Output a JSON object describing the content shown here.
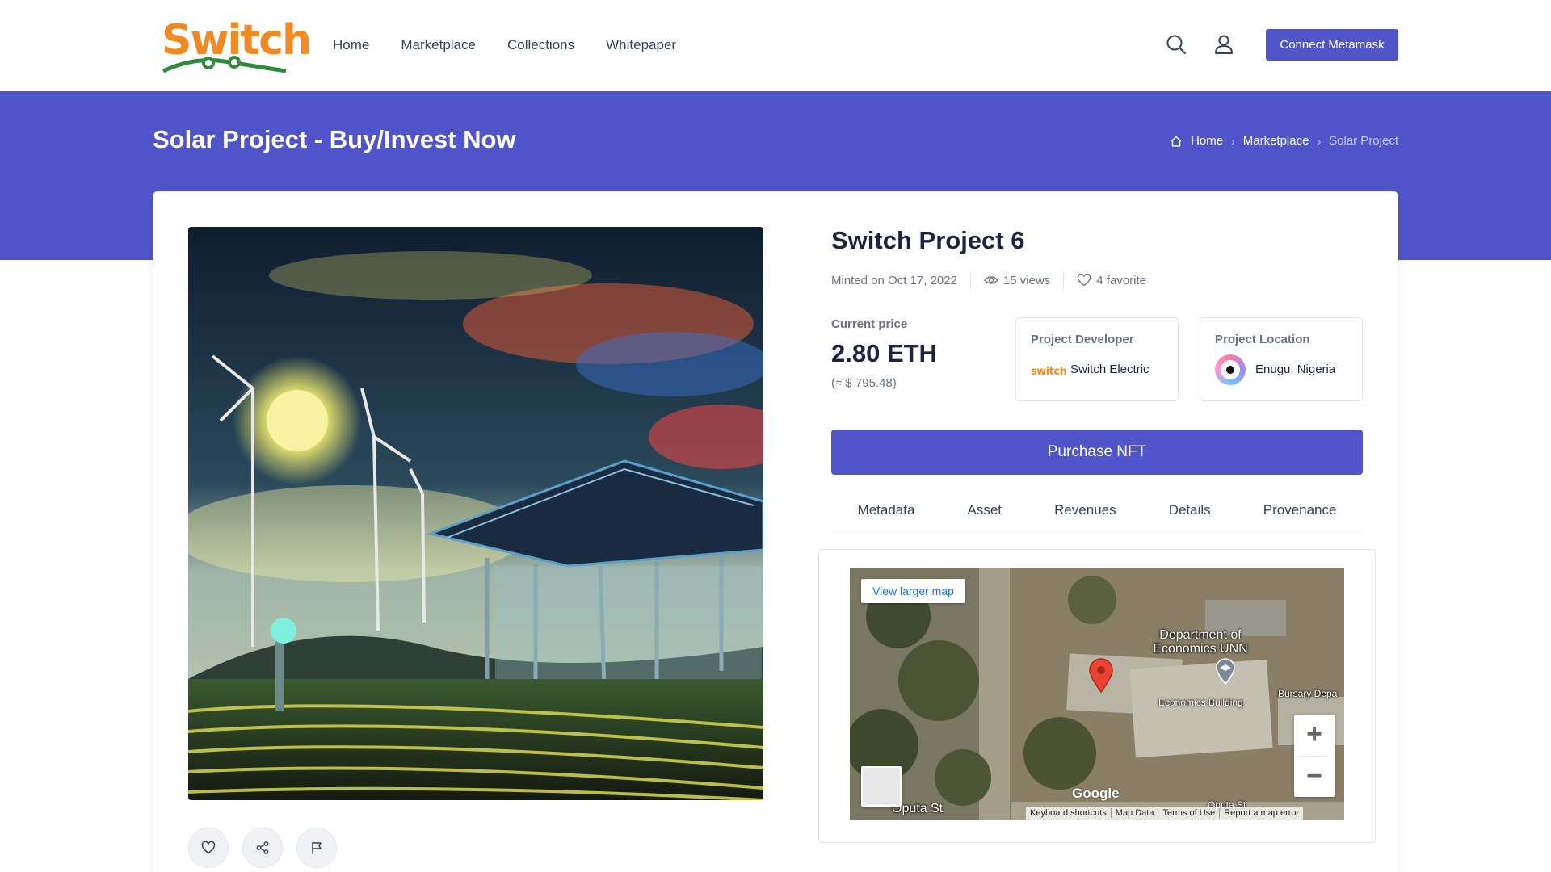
{
  "header": {
    "logo_text": "Switch",
    "nav": [
      "Home",
      "Marketplace",
      "Collections",
      "Whitepaper"
    ],
    "connect_label": "Connect Metamask"
  },
  "banner": {
    "title": "Solar Project - Buy/Invest Now",
    "breadcrumb": [
      "Home",
      "Marketplace",
      "Solar Project"
    ]
  },
  "project": {
    "title": "Switch Project 6",
    "minted": "Minted on Oct 17, 2022",
    "views": "15 views",
    "favorites": "4 favorite",
    "price_label": "Current price",
    "price": "2.80 ETH",
    "price_usd": "(≈ $ 795.48)",
    "developer_label": "Project Developer",
    "developer_logo": "switch",
    "developer": "Switch Electric",
    "location_label": "Project Location",
    "location": "Enugu, Nigeria",
    "purchase_label": "Purchase NFT"
  },
  "tabs": [
    "Metadata",
    "Asset",
    "Revenues",
    "Details",
    "Provenance"
  ],
  "map": {
    "view_larger": "View larger map",
    "label_dept": "Department of Economics UNN",
    "label_building": "Economics Building",
    "label_bursary": "Bursary Depa",
    "label_street": "Oputa St",
    "label_street2": "Oputa St",
    "google": "Google",
    "footer": [
      "Keyboard shortcuts",
      "Map Data",
      "Terms of Use",
      "Report a map error"
    ]
  },
  "colors": {
    "brand": "#4f55c9",
    "logo_orange": "#f08a24",
    "logo_green": "#2e8b3a"
  },
  "icons": [
    "search-icon",
    "user-icon",
    "home-icon",
    "eye-icon",
    "heart-icon",
    "share-icon",
    "flag-icon",
    "map-pin-icon"
  ]
}
